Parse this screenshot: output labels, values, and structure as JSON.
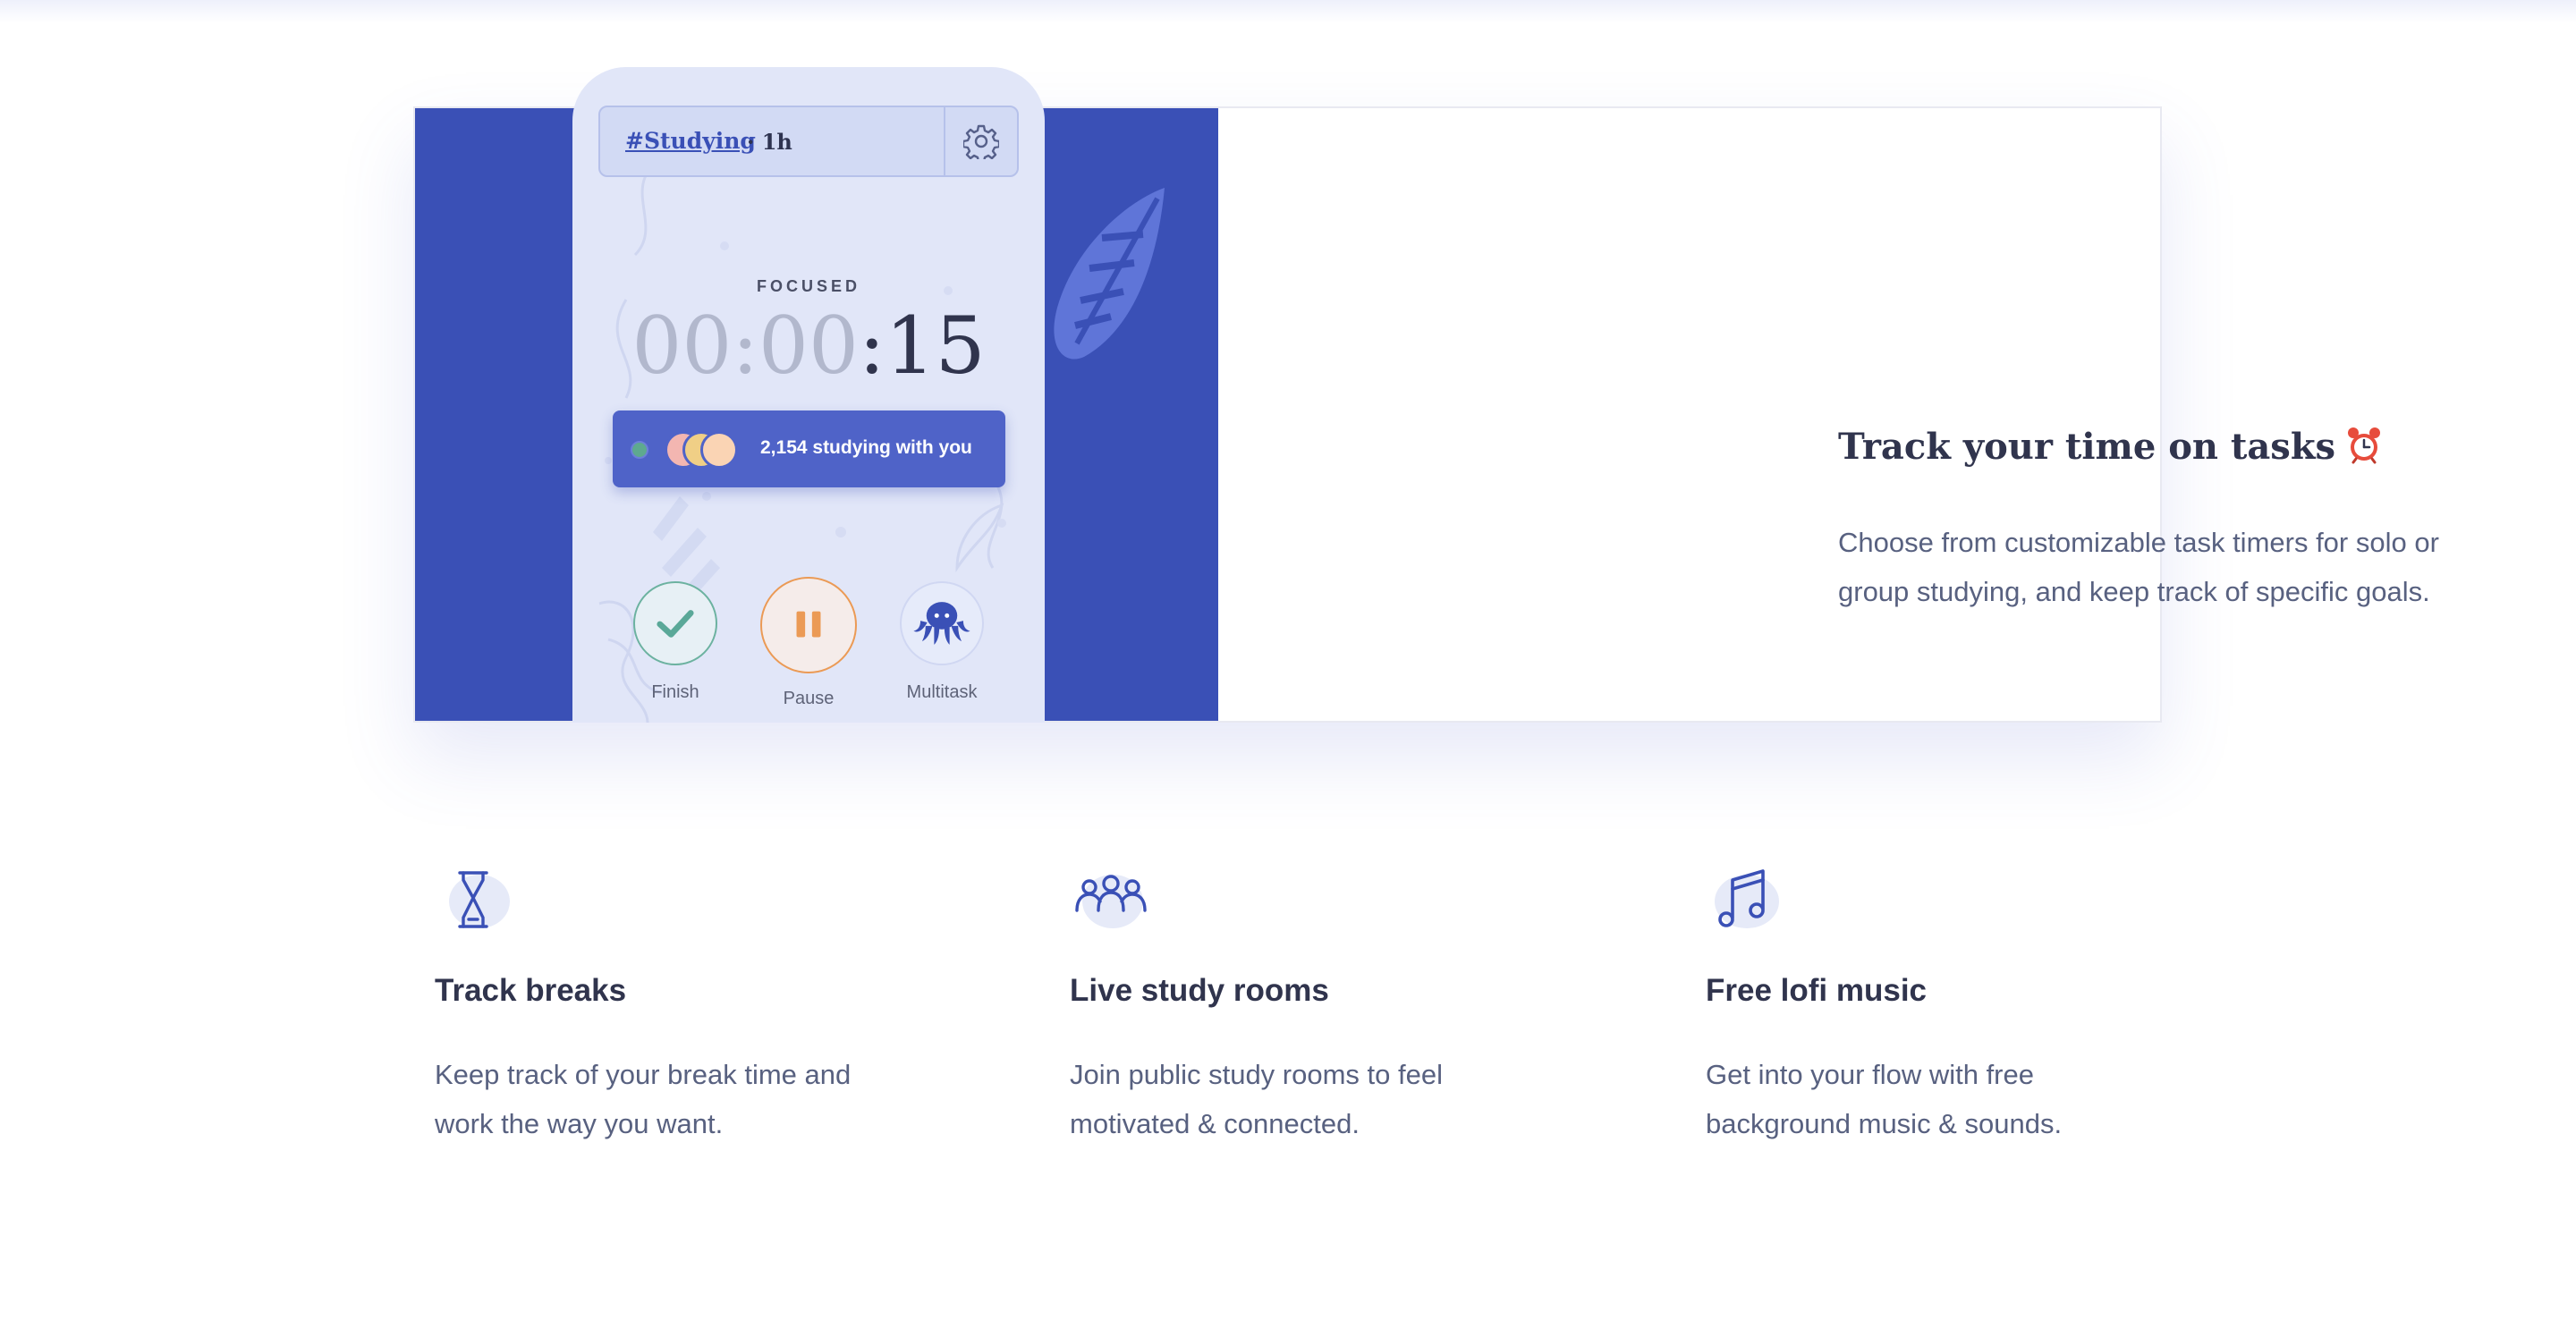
{
  "app": {
    "task_tag": "#Studying",
    "task_duration": "· 1h",
    "timer_status": "FOCUSED",
    "timer_dim": "00:00",
    "timer_bright": ":15",
    "studying_count": "2,154 studying with you",
    "controls": {
      "finish_label": "Finish",
      "pause_label": "Pause",
      "multitask_label": "Multitask"
    }
  },
  "hero": {
    "title": "Track your time on tasks",
    "title_icon": "alarm-clock-icon",
    "description": "Choose from customizable task timers for solo or group studying, and keep track of specific goals."
  },
  "features": [
    {
      "icon": "hourglass-icon",
      "title": "Track breaks",
      "description": "Keep track of your break time and work the way you want."
    },
    {
      "icon": "people-group-icon",
      "title": "Live study rooms",
      "description": "Join public study rooms to feel motivated & connected."
    },
    {
      "icon": "music-note-icon",
      "title": "Free lofi music",
      "description": "Get into your flow with free background music & sounds."
    }
  ],
  "colors": {
    "brand_blue": "#3a50b6",
    "phone_bg": "#e1e6f8",
    "pill_blue": "#4f63c8",
    "heading": "#30344d",
    "body_text": "#586180",
    "finish_green": "#5aa898",
    "pause_orange": "#eb9a55"
  }
}
